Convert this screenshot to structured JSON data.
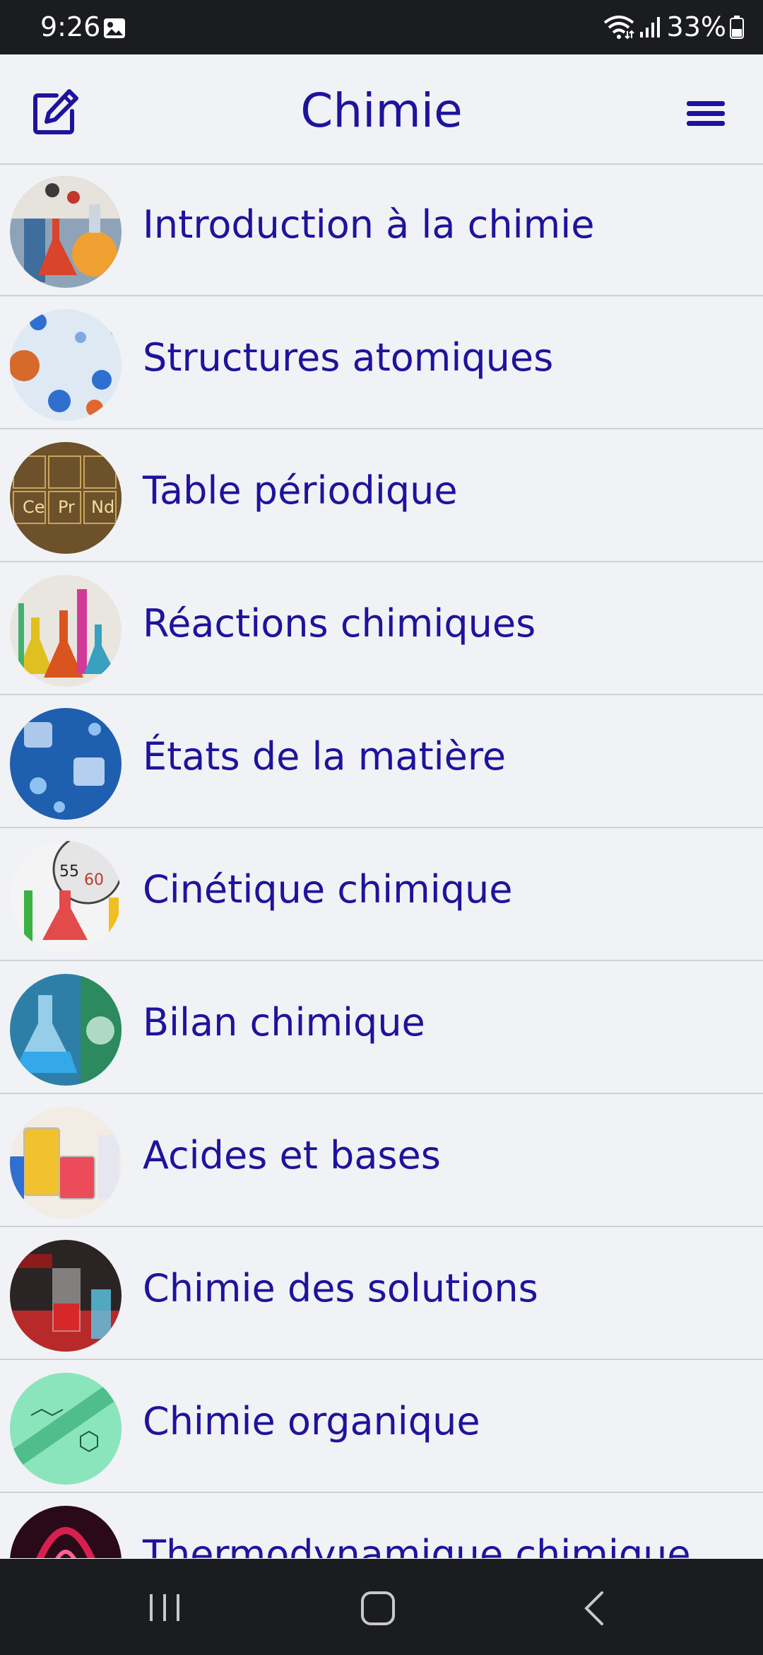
{
  "status_bar": {
    "time": "9:26",
    "battery": "33%"
  },
  "header": {
    "title": "Chimie"
  },
  "topics": [
    {
      "label": "Introduction à la chimie"
    },
    {
      "label": "Structures atomiques"
    },
    {
      "label": "Table périodique"
    },
    {
      "label": "Réactions chimiques"
    },
    {
      "label": "États de la matière"
    },
    {
      "label": "Cinétique chimique"
    },
    {
      "label": "Bilan chimique"
    },
    {
      "label": "Acides et bases"
    },
    {
      "label": "Chimie des solutions"
    },
    {
      "label": "Chimie organique"
    },
    {
      "label": "Thermodynamique chimique"
    }
  ],
  "colors": {
    "accent": "#1e139c",
    "background": "#f1f2f5",
    "system_bar": "#1b1c20",
    "divider": "#cfd0d4"
  },
  "icons": {
    "edit": "edit-icon",
    "menu": "hamburger-menu-icon",
    "nav_recent": "recent-apps-icon",
    "nav_home": "home-icon",
    "nav_back": "back-icon"
  }
}
